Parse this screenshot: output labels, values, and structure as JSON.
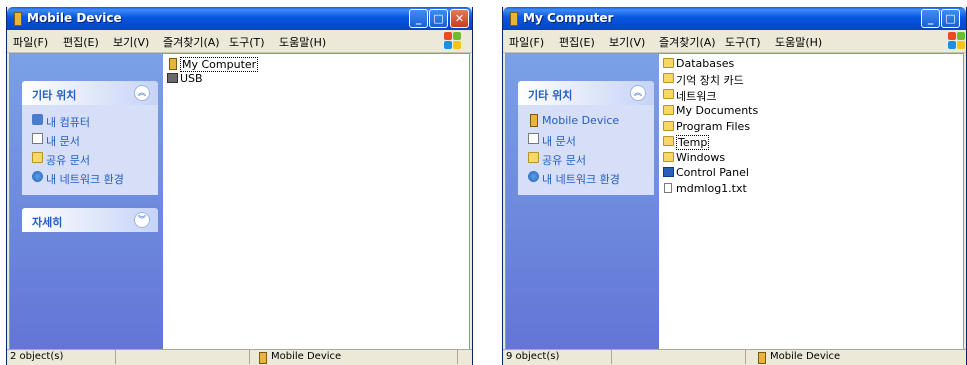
{
  "colors": {
    "title_start": "#0a5fe6",
    "title_end": "#0443c9",
    "task_pane": "#6375d6",
    "link": "#215dc6"
  },
  "windows": [
    {
      "title": "Mobile Device",
      "menu": [
        "파일(F)",
        "편집(E)",
        "보기(V)",
        "즐겨찾기(A)",
        "도구(T)",
        "도움말(H)"
      ],
      "places_header": "기타 위치",
      "places": [
        {
          "label": "내 컴퓨터",
          "icon": "pc-icon"
        },
        {
          "label": "내 문서",
          "icon": "documents-icon"
        },
        {
          "label": "공유 문서",
          "icon": "folder-icon"
        },
        {
          "label": "내 네트워크 환경",
          "icon": "network-icon"
        }
      ],
      "details_header": "자세히",
      "files": [
        {
          "label": "My Computer",
          "icon": "device-icon",
          "selected": true
        },
        {
          "label": "USB",
          "icon": "usb-icon"
        }
      ],
      "status_count": "2 object(s)",
      "status_location": "Mobile Device"
    },
    {
      "title": "My Computer",
      "menu": [
        "파일(F)",
        "편집(E)",
        "보기(V)",
        "즐겨찾기(A)",
        "도구(T)",
        "도움말(H)"
      ],
      "places_header": "기타 위치",
      "places": [
        {
          "label": "Mobile Device",
          "icon": "device-icon"
        },
        {
          "label": "내 문서",
          "icon": "documents-icon"
        },
        {
          "label": "공유 문서",
          "icon": "folder-icon"
        },
        {
          "label": "내 네트워크 환경",
          "icon": "network-icon"
        }
      ],
      "files": [
        {
          "label": "Databases",
          "icon": "database-icon"
        },
        {
          "label": "기억 장치 카드",
          "icon": "folder-icon"
        },
        {
          "label": "네트워크",
          "icon": "folder-icon"
        },
        {
          "label": "My Documents",
          "icon": "folder-icon"
        },
        {
          "label": "Program Files",
          "icon": "folder-icon"
        },
        {
          "label": "Temp",
          "icon": "folder-icon",
          "selected": true
        },
        {
          "label": "Windows",
          "icon": "folder-icon"
        },
        {
          "label": "Control Panel",
          "icon": "control-panel-icon"
        },
        {
          "label": "mdmlog1.txt",
          "icon": "text-file-icon"
        }
      ],
      "status_count": "9 object(s)",
      "status_location": "Mobile Device"
    }
  ]
}
